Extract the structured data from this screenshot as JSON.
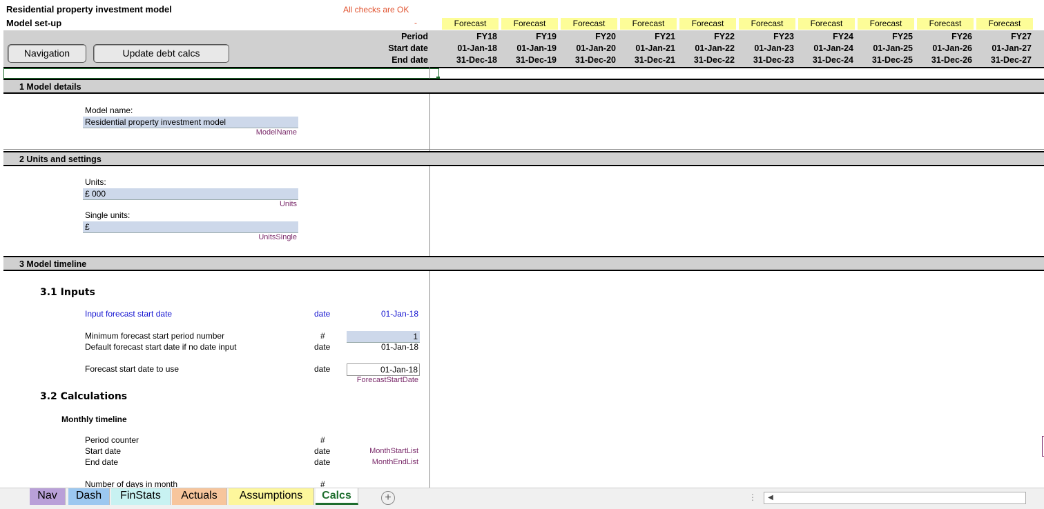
{
  "header": {
    "title": "Residential property investment model",
    "subtitle": "Model set-up",
    "checks_status": "All checks are OK",
    "checks_dash": "-",
    "period_label": "Period",
    "start_label": "Start date",
    "end_label": "End date",
    "forecast_label": "Forecast"
  },
  "buttons": {
    "navigation": "Navigation",
    "update_debt": "Update debt calcs"
  },
  "periods": [
    {
      "fy": "FY18",
      "start": "01-Jan-18",
      "end": "31-Dec-18"
    },
    {
      "fy": "FY19",
      "start": "01-Jan-19",
      "end": "31-Dec-19"
    },
    {
      "fy": "FY20",
      "start": "01-Jan-20",
      "end": "31-Dec-20"
    },
    {
      "fy": "FY21",
      "start": "01-Jan-21",
      "end": "31-Dec-21"
    },
    {
      "fy": "FY22",
      "start": "01-Jan-22",
      "end": "31-Dec-22"
    },
    {
      "fy": "FY23",
      "start": "01-Jan-23",
      "end": "31-Dec-23"
    },
    {
      "fy": "FY24",
      "start": "01-Jan-24",
      "end": "31-Dec-24"
    },
    {
      "fy": "FY25",
      "start": "01-Jan-25",
      "end": "31-Dec-25"
    },
    {
      "fy": "FY26",
      "start": "01-Jan-26",
      "end": "31-Dec-26"
    },
    {
      "fy": "FY27",
      "start": "01-Jan-27",
      "end": "31-Dec-27"
    }
  ],
  "sections": {
    "model_details": "1 Model details",
    "units_settings": "2 Units and settings",
    "model_timeline": "3 Model timeline"
  },
  "model_details": {
    "name_label": "Model name:",
    "name_value": "Residential property investment model",
    "name_range": "ModelName"
  },
  "units": {
    "units_label": "Units:",
    "units_value": "£ 000",
    "units_range": "Units",
    "single_label": "Single units:",
    "single_value": "£",
    "single_range": "UnitsSingle"
  },
  "timeline": {
    "inputs_heading": "3.1 Inputs",
    "input_start_label": "Input forecast start date",
    "input_start_unit": "date",
    "input_start_value": "01-Jan-18",
    "min_period_label": "Minimum forecast start period number",
    "min_period_unit": "#",
    "min_period_value": "1",
    "default_start_label": "Default forecast start date if no date input",
    "default_start_unit": "date",
    "default_start_value": "01-Jan-18",
    "use_start_label": "Forecast start date to use",
    "use_start_unit": "date",
    "use_start_value": "01-Jan-18",
    "use_start_range": "ForecastStartDate",
    "calcs_heading": "3.2 Calculations",
    "monthly_heading": "Monthly timeline",
    "period_counter_label": "Period counter",
    "period_counter_unit": "#",
    "start_date_label": "Start date",
    "start_date_unit": "date",
    "start_date_range": "MonthStartList",
    "end_date_label": "End date",
    "end_date_unit": "date",
    "end_date_range": "MonthEndList",
    "days_label": "Number of days in month",
    "days_unit": "#"
  },
  "tabs": [
    {
      "label": "Nav",
      "color": "#b9a0d8"
    },
    {
      "label": "Dash",
      "color": "#9cc8f0"
    },
    {
      "label": "FinStats",
      "color": "#c8f2f2"
    },
    {
      "label": "Actuals",
      "color": "#f7c59c"
    },
    {
      "label": "Assumptions",
      "color": "#fdf79c"
    },
    {
      "label": "Calcs",
      "color": "#ffffff",
      "active": true
    }
  ],
  "colors": {
    "input_fill": "#cdd8ea",
    "forecast_fill": "#fdfd98",
    "section_fill": "#d0d0d0",
    "checks_text": "#e0502c",
    "range_name_text": "#7a2a6a",
    "input_text_blue": "#1212d0"
  }
}
